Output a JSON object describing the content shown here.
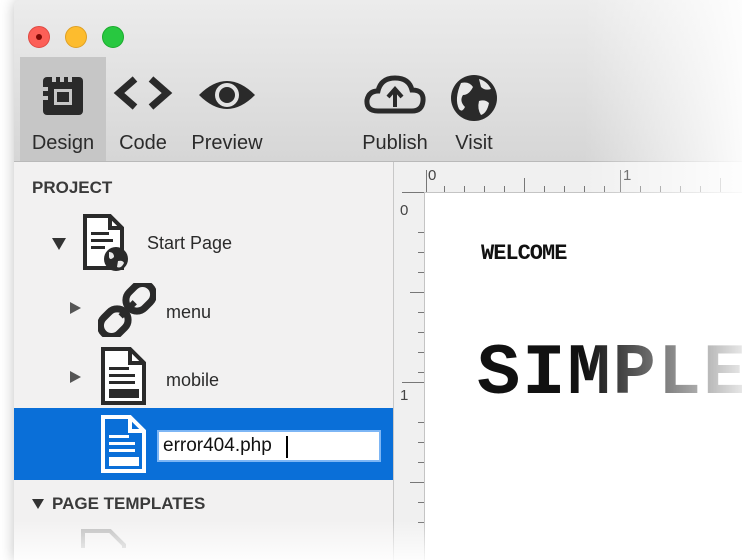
{
  "toolbar": {
    "buttons": [
      {
        "label": "Design",
        "icon": "design-icon",
        "active": true
      },
      {
        "label": "Code",
        "icon": "code-icon"
      },
      {
        "label": "Preview",
        "icon": "eye-icon"
      },
      {
        "label": "Publish",
        "icon": "cloud-upload-icon"
      },
      {
        "label": "Visit",
        "icon": "globe-icon"
      }
    ]
  },
  "sidebar": {
    "project_heading": "PROJECT",
    "items": [
      {
        "label": "Start Page",
        "icon": "web-page-icon",
        "expanded": true
      },
      {
        "label": "menu",
        "icon": "link-icon"
      },
      {
        "label": "mobile",
        "icon": "page-icon"
      },
      {
        "label": "error404.php",
        "icon": "page-icon",
        "selected": true,
        "editing": true
      }
    ],
    "templates_heading": "PAGE TEMPLATES"
  },
  "canvas": {
    "ruler_top_labels": [
      "0",
      "1"
    ],
    "ruler_left_labels": [
      "0",
      "1"
    ],
    "welcome_text": "WELCOME",
    "hero_text": "SIMPLE"
  },
  "colors": {
    "selection": "#0a6fd8",
    "toolbar_active": "#c6c6c6"
  }
}
